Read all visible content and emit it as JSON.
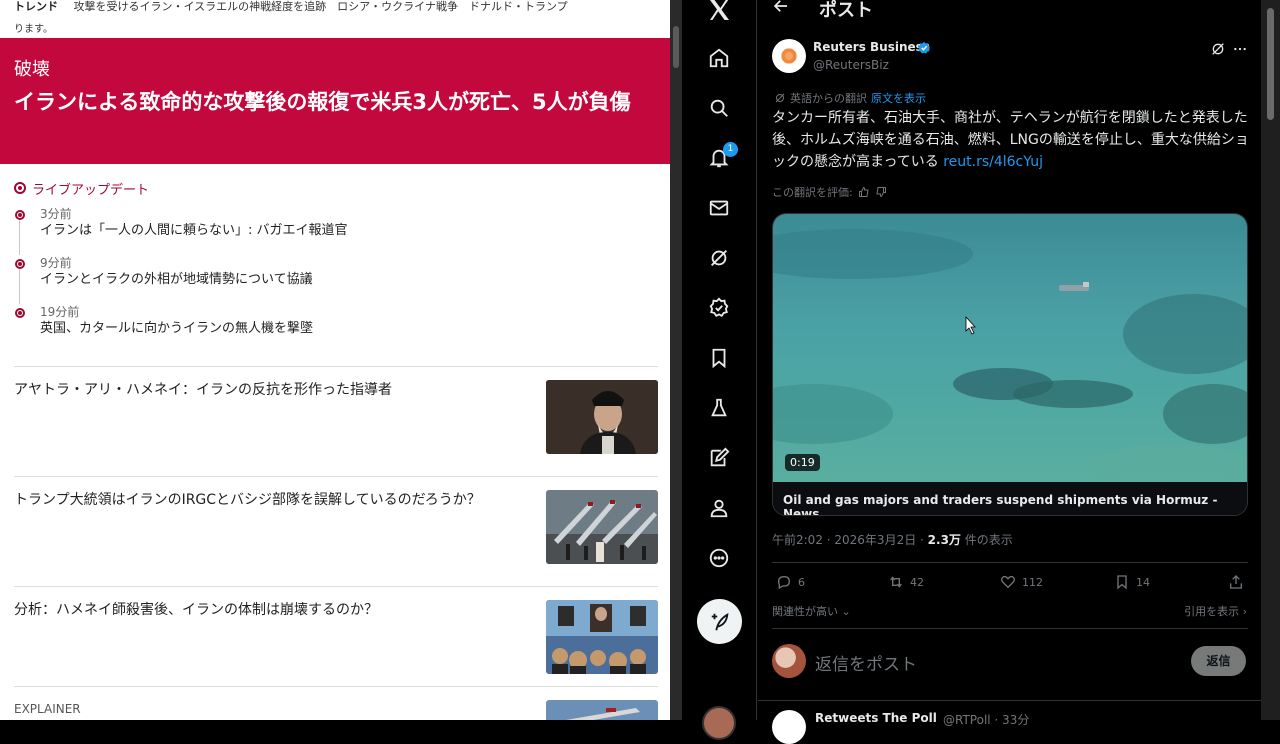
{
  "reuters": {
    "trend_label": "トレンド",
    "trend_text": "攻撃を受けるイラン・イスラエルの神戦経度を追跡　ロシア・ウクライナ戦争　ドナルド・トランプ",
    "trend_text_cont": "ります。",
    "hero": {
      "kicker": "破壊",
      "title": "イランによる致命的な攻撃後の報復で米兵3人が死亡、5人が負傷"
    },
    "live": {
      "heading": "ライブアップデート",
      "items": [
        {
          "time": "3分前",
          "text": "イランは「一人の人間に頼らない」: バガエイ報道官"
        },
        {
          "time": "9分前",
          "text": "イランとイラクの外相が地域情勢について協議"
        },
        {
          "time": "19分前",
          "text": "英国、カタールに向かうイランの無人機を撃墜"
        }
      ]
    },
    "stories": [
      {
        "text": "アヤトラ・アリ・ハメネイ：イランの反抗を形作った指導者"
      },
      {
        "text": "トランプ大統領はイランのIRGCとバシジ部隊を誤解しているのだろうか？"
      },
      {
        "text": "分析：ハメネイ師殺害後、イランの体制は崩壊するのか？"
      },
      {
        "text": "EXPLAINER"
      }
    ]
  },
  "xnav": {
    "logo": "x-logo",
    "notification_count": "1",
    "icons": [
      "home-icon",
      "search-icon",
      "bell-icon",
      "mail-icon",
      "grok-icon",
      "verified-icon",
      "bookmark-icon",
      "flask-icon",
      "edit-icon",
      "profile-icon",
      "more-icon"
    ]
  },
  "post": {
    "header_title": "ポスト",
    "author": {
      "name": "Reuters Business",
      "handle": "@ReutersBiz",
      "avatar_text": "REUTERS"
    },
    "translated_label": "英語からの翻訳",
    "show_original": "原文を表示",
    "text": "タンカー所有者、石油大手、商社が、テヘランが航行を閉鎖したと発表した後、ホルムズ海峡を通る石油、燃料、LNGの輸送を停止し、重大な供給ショックの懸念が高まっている",
    "url": "reut.rs/4l6cYuj",
    "rate_translation": "この翻訳を評価:",
    "video": {
      "duration": "0:19",
      "card_title": "Oil and gas majors and traders suspend shipments via Hormuz - News"
    },
    "meta": {
      "time": "午前2:02 · 2026年3月2日 ·",
      "views": "2.3万",
      "views_label": "件の表示"
    },
    "actions": {
      "replies": "6",
      "reposts": "42",
      "likes": "112",
      "bookmarks": "14"
    },
    "relevance": "関連性が高い",
    "quotes": "引用を表示",
    "reply_placeholder": "返信をポスト",
    "reply_button": "返信",
    "next": {
      "name": "Retweets The Poll",
      "handle": "@RTPoll · 33分"
    }
  },
  "colors": {
    "reuters_red": "#c2083c",
    "x_blue": "#1d9bf0",
    "x_bg": "#000000"
  }
}
